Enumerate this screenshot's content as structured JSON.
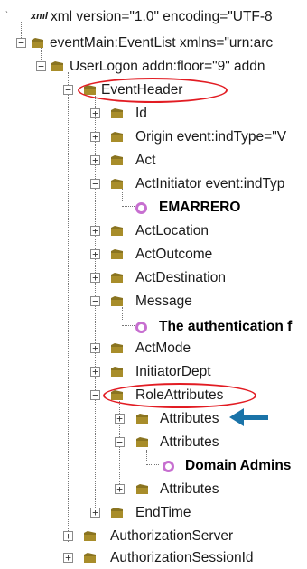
{
  "tree": {
    "declaration_tag": "xml",
    "declaration": "xml version=\"1.0\" encoding=\"UTF-8",
    "root": "eventMain:EventList xmlns=\"urn:arc",
    "user_logon": "UserLogon addn:floor=\"9\"  addn",
    "event_header": "EventHeader",
    "id": "Id",
    "origin": "Origin event:indType=\"V",
    "act": "Act",
    "act_initiator": "ActInitiator event:indTyp",
    "emarrero": "EMARRERO",
    "act_location": "ActLocation",
    "act_outcome": "ActOutcome",
    "act_destination": "ActDestination",
    "message": "Message",
    "message_value": "The authentication f",
    "act_mode": "ActMode",
    "initiator_dept": "InitiatorDept",
    "role_attributes": "RoleAttributes",
    "attributes_1": "Attributes",
    "attributes_2": "Attributes",
    "domain_admins": "Domain Admins",
    "attributes_3": "Attributes",
    "end_time": "EndTime",
    "authorization_server": "AuthorizationServer",
    "authorization_session_id": "AuthorizationSessionId"
  },
  "colors": {
    "highlight_ellipse": "#e21c23",
    "arrow": "#1a73a8",
    "value_ring": "#c76fd0",
    "folder": "#8a7420"
  },
  "icons": {
    "collapsed": "plus",
    "expanded": "minus"
  }
}
